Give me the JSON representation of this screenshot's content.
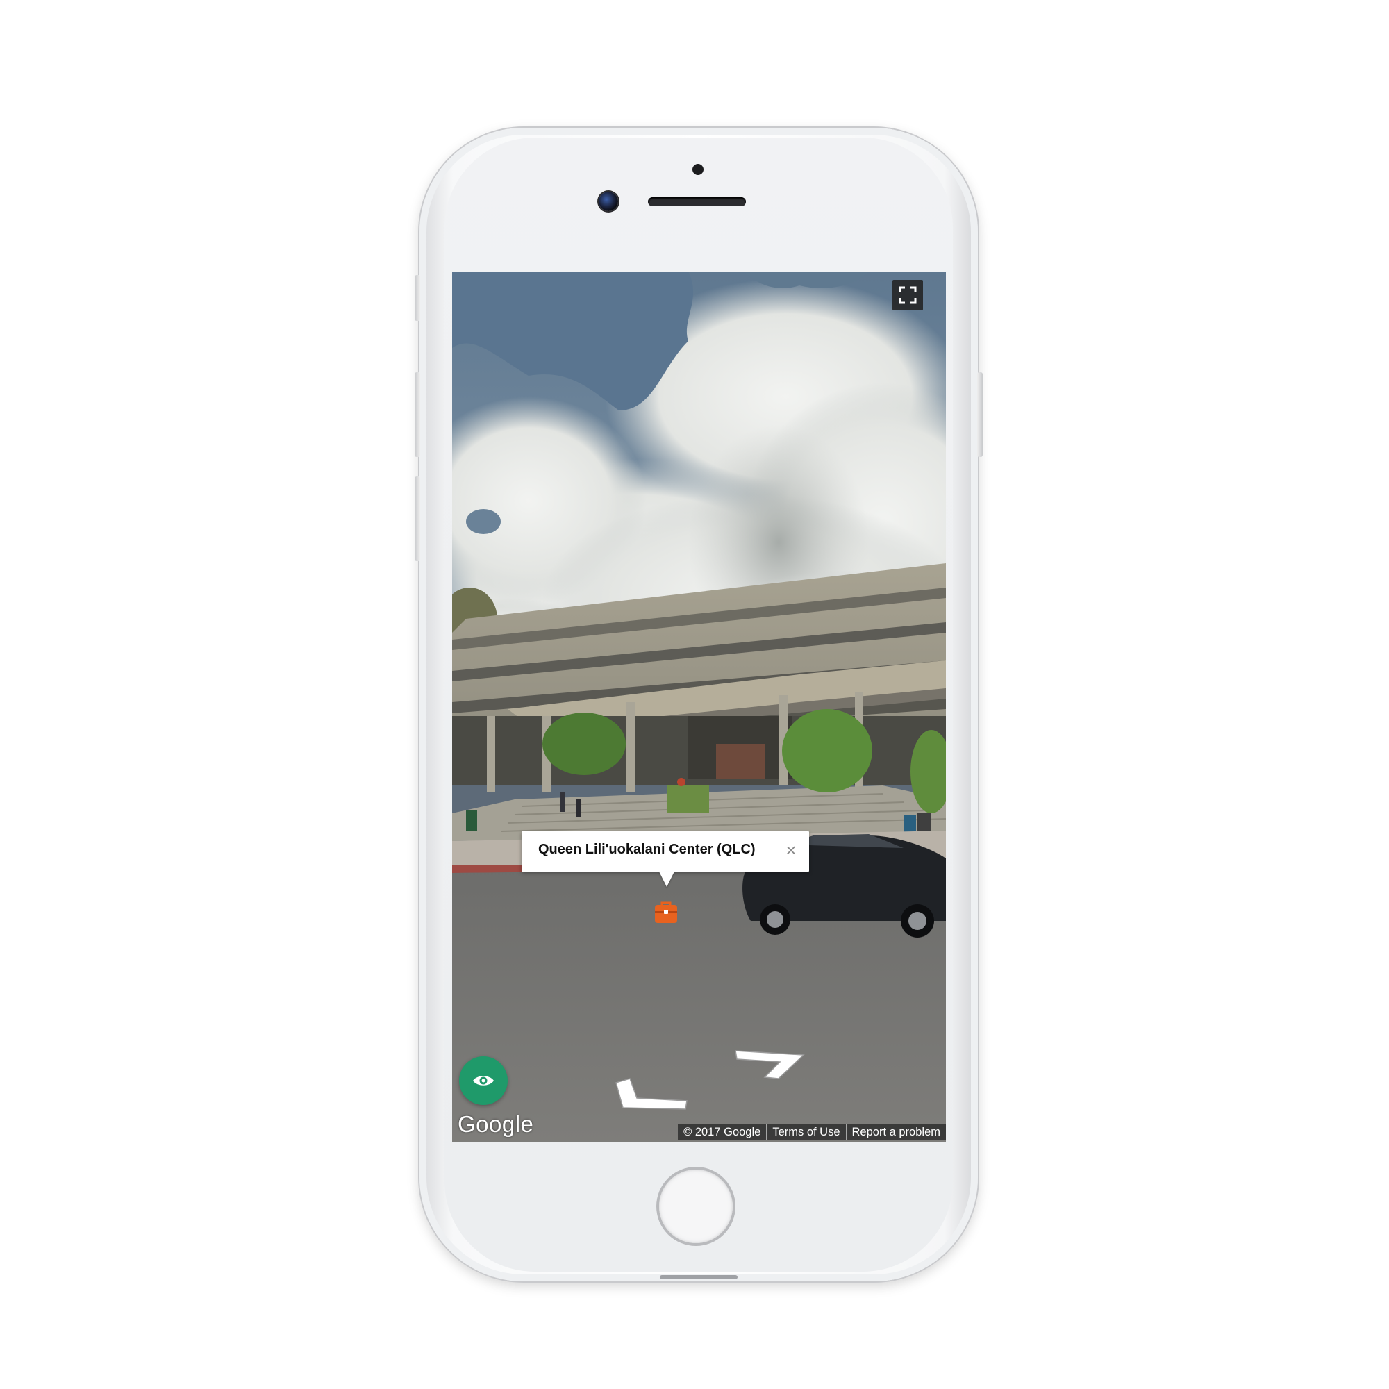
{
  "street_view": {
    "place_name": "Queen Lili'uokalani Center (QLC)",
    "close_glyph": "×",
    "brand": "Google",
    "attribution": {
      "copyright": "© 2017 Google",
      "terms": "Terms of Use",
      "report": "Report a problem"
    },
    "icons": {
      "fullscreen": "fullscreen-icon",
      "pegman_view": "eye-icon",
      "place_marker": "briefcase-icon",
      "nav_left": "arrow-left-icon",
      "nav_right": "arrow-right-icon"
    }
  },
  "colors": {
    "marker": "#e8621f",
    "eye_button": "#1f9a6a",
    "phone_frame": "#f3f4f5"
  }
}
